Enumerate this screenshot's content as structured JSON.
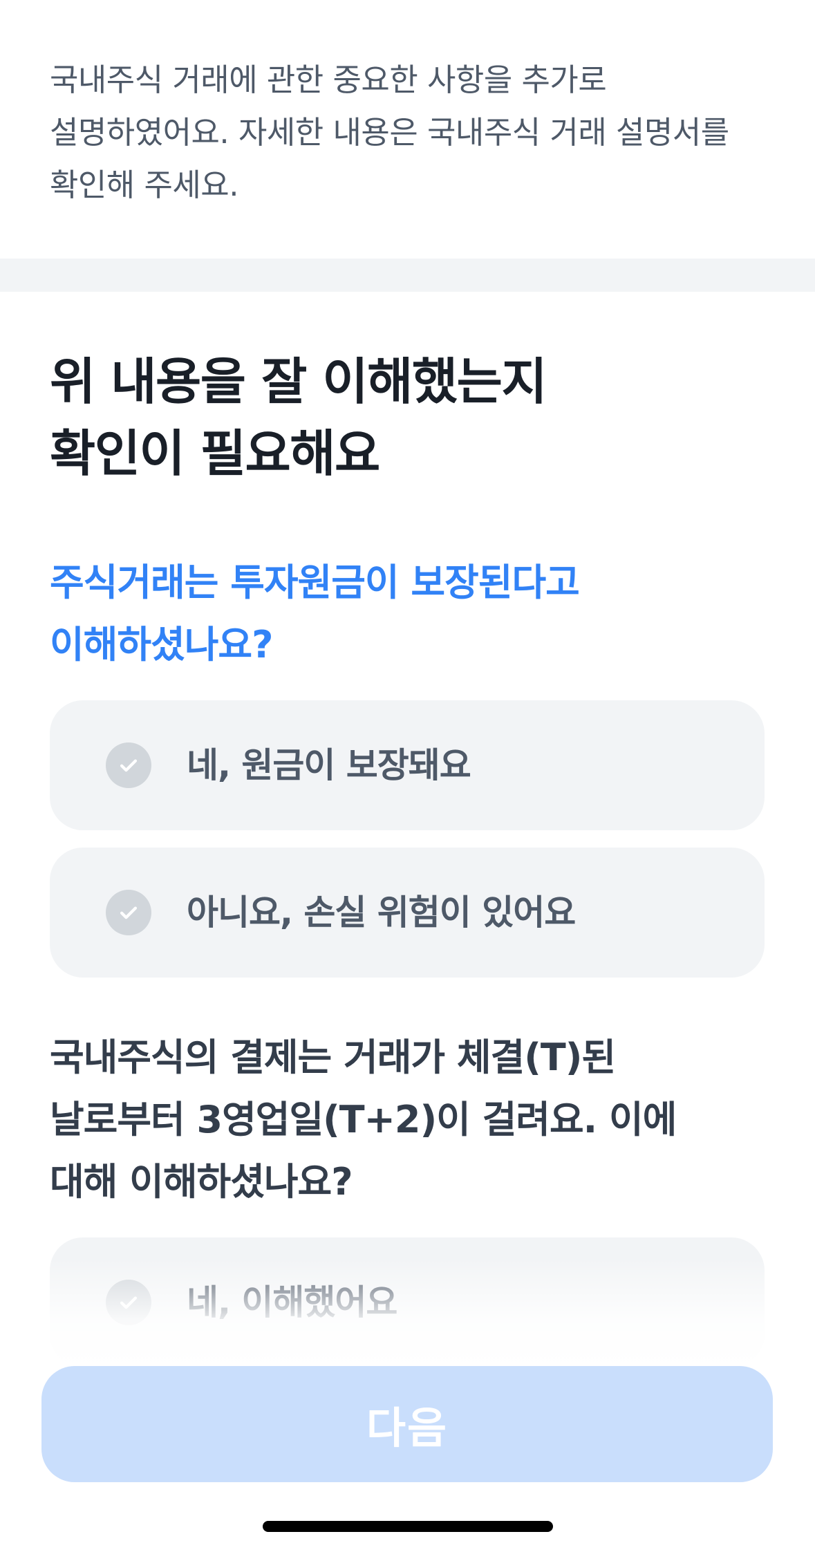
{
  "intro": {
    "line1": "국내주식 거래에 관한 중요한 사항을 추가로",
    "line2": "설명하였어요. 자세한 내용은 국내주식 거래 설명서를",
    "line3": "확인해 주세요."
  },
  "heading": {
    "line1": "위 내용을 잘 이해했는지",
    "line2": "확인이 필요해요"
  },
  "question1": {
    "line1": "주식거래는 투자원금이 보장된다고",
    "line2": "이해하셨나요?",
    "options": [
      {
        "label": "네, 원금이 보장돼요",
        "icon": "check-circle-icon"
      },
      {
        "label": "아니요, 손실 위험이 있어요",
        "icon": "check-circle-icon"
      }
    ]
  },
  "question2": {
    "line1": "국내주식의 결제는 거래가 체결(T)된",
    "line2": "날로부터 3영업일(T+2)이 걸려요. 이에",
    "line3": "대해 이해하셨나요?",
    "options": [
      {
        "label": "네, 이해했어요",
        "icon": "check-circle-icon"
      }
    ]
  },
  "footer": {
    "next_label": "다음"
  },
  "colors": {
    "accent": "#3182f6",
    "button_disabled": "#c9defc",
    "option_bg": "#f2f4f6",
    "check_inactive": "#d1d6db"
  }
}
